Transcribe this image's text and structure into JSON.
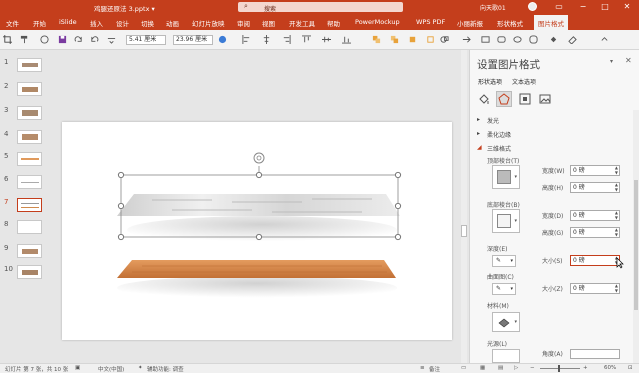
{
  "window": {
    "title": "鸡腿还原法 3.pptx ▾",
    "search_placeholder": "搜索",
    "user": "向天歌01"
  },
  "menu": [
    "文件",
    "开始",
    "iSlide",
    "插入",
    "设计",
    "切换",
    "动画",
    "幻灯片放映",
    "审阅",
    "视图",
    "开发工具",
    "帮助",
    "PowerMockup",
    "WPS PDF",
    "小丽新报",
    "形状格式",
    "图片格式"
  ],
  "menu_selected": "图片格式",
  "toolbar": {
    "width": "5.41 厘米",
    "height": "23.96 厘米"
  },
  "thumbnails": [
    "1",
    "2",
    "3",
    "4",
    "5",
    "6",
    "7",
    "8",
    "9",
    "10"
  ],
  "active_slide": "7",
  "panel": {
    "title": "设置图片格式",
    "tabs": [
      "形状选项",
      "文本选项"
    ],
    "sections": {
      "glow": "发光",
      "soft_edges": "柔化边缘",
      "bevel3d": "三维格式"
    },
    "top_bevel": "顶部棱台(T)",
    "bottom_bevel": "底部棱台(B)",
    "width_label": "宽度(W)",
    "height_label": "高度(H)",
    "width_d_label": "宽度(D)",
    "height_g_label": "高度(G)",
    "depth": "深度(E)",
    "size_e": "大小(S)",
    "contour": "曲面图(C)",
    "size_z": "大小(Z)",
    "material": "材料(M)",
    "lighting": "光源(L)",
    "angle": "角度(A)",
    "values": {
      "tw": "0 磅",
      "th": "0 磅",
      "bw": "0 磅",
      "bh": "0 磅",
      "depth": "0 磅",
      "contour": "0 磅"
    }
  },
  "status": {
    "slide": "幻灯片 第 7 张，共 10 张",
    "lang": "中文(中国)",
    "access": "辅助功能: 调查",
    "notes": "备注",
    "zoom": "60%"
  }
}
